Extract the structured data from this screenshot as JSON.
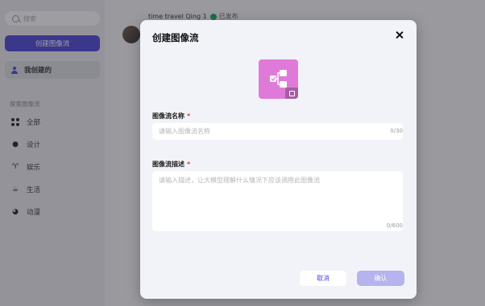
{
  "sidebar": {
    "search_placeholder": "搜索",
    "create_button": "创建图像流",
    "mine_label": "我创建的",
    "section_title": "探索图像流",
    "categories": [
      {
        "label": "全部",
        "icon": "grid-icon"
      },
      {
        "label": "设计",
        "icon": "palette-icon"
      },
      {
        "label": "娱乐",
        "icon": "trophy-icon"
      },
      {
        "label": "生活",
        "icon": "cup-icon"
      },
      {
        "label": "动漫",
        "icon": "bear-icon"
      }
    ]
  },
  "post": {
    "author": "time travel Qing 1",
    "status": "已发布"
  },
  "modal": {
    "title": "创建图像流",
    "name_label": "图像流名称",
    "name_placeholder": "请输入图像流名称",
    "name_counter": "0/30",
    "desc_label": "图像流描述",
    "desc_placeholder": "请输入描述，让大模型理解什么情况下应该调用此图像流",
    "desc_counter": "0/600",
    "required_mark": "*",
    "cancel_label": "取消",
    "confirm_label": "确认",
    "logo_color": "#e07ad9",
    "accent_color": "#4b44d6"
  }
}
